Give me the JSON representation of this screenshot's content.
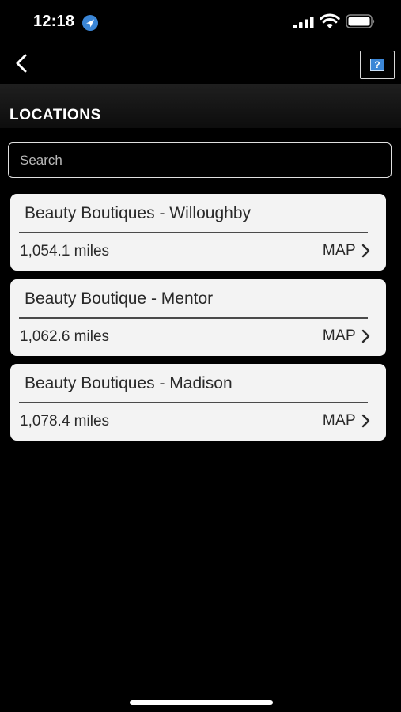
{
  "status_bar": {
    "time": "12:18",
    "icons": [
      "location-arrow-icon",
      "cellular-signal-icon",
      "wifi-icon",
      "battery-icon"
    ]
  },
  "nav": {
    "back_icon": "chevron-left-icon",
    "help_icon": "help-icon",
    "help_glyph": "?"
  },
  "header": {
    "title": "LOCATIONS"
  },
  "search": {
    "placeholder": "Search",
    "value": ""
  },
  "locations": [
    {
      "name": "Beauty Boutiques - Willoughby",
      "distance": "1,054.1 miles",
      "map_label": "MAP"
    },
    {
      "name": "Beauty Boutique - Mentor",
      "distance": "1,062.6 miles",
      "map_label": "MAP"
    },
    {
      "name": "Beauty Boutiques - Madison",
      "distance": "1,078.4 miles",
      "map_label": "MAP"
    }
  ],
  "colors": {
    "background": "#000000",
    "card": "#f3f3f3",
    "help_icon": "#3b86d6",
    "location_arrow": "#3b86d6"
  }
}
